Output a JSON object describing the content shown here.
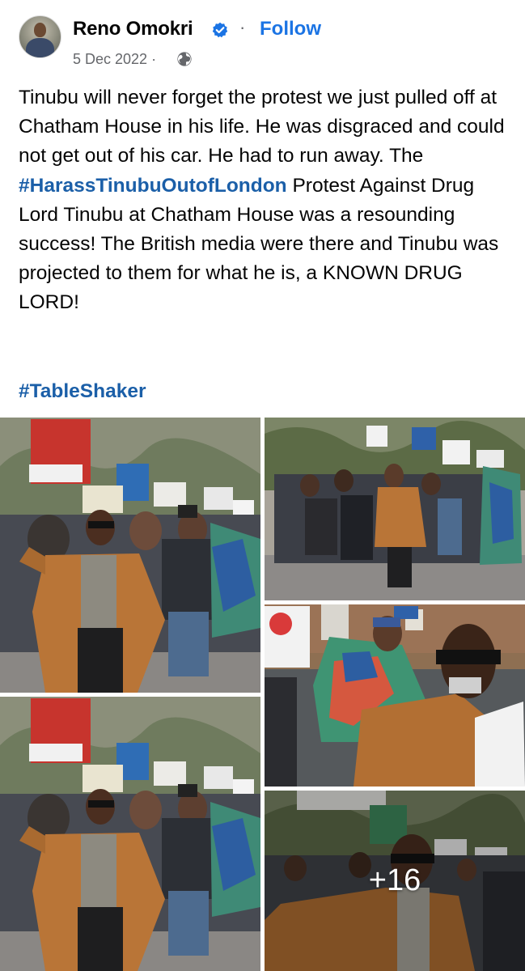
{
  "post": {
    "author": "Reno Omokri",
    "separator": "·",
    "follow_label": "Follow",
    "date": "5 Dec 2022 ·",
    "text_part1": "Tinubu will never forget the protest we just pulled off at Chatham House in his life. He was disgraced and could not get out of his car. He had to run away. The ",
    "hashtag1": "#HarassTinubuOutofLondon",
    "text_part2": " Protest Against Drug Lord Tinubu at Chatham House was a resounding success! The British media were there and Tinubu was projected to them for what he is, a KNOWN DRUG LORD!",
    "hashtag2": "#TableShaker"
  },
  "photos": {
    "more_count": "+16"
  },
  "colors": {
    "link_blue": "#1b74e4",
    "hashtag_blue": "#1b5fa8",
    "verified_blue": "#1b74e4",
    "meta_gray": "#65676b"
  },
  "icons": {
    "verified": "verified-badge-icon",
    "privacy": "globe-icon"
  }
}
